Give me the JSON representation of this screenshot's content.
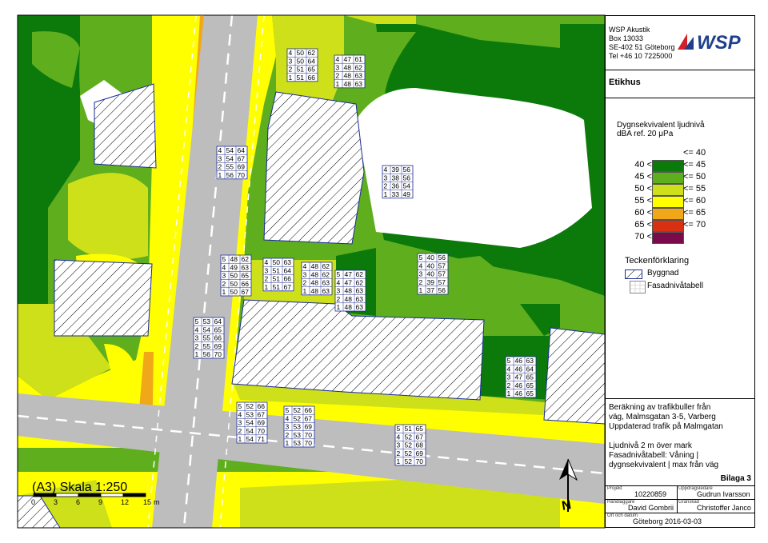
{
  "company": {
    "name": "WSP Akustik",
    "box": "Box 13033",
    "address": "SE-402 51 Göteborg",
    "phone": "Tel +46 10 7225000",
    "logo_text": "WSP"
  },
  "project_title": "Etikhus",
  "legend": {
    "title_line1": "Dygnsekvivalent ljudnivå",
    "title_line2": "dBA ref. 20 μPa",
    "classes": [
      {
        "low": "",
        "high": "<= 40",
        "color": "#ffffff"
      },
      {
        "low": "40 <",
        "high": "<= 45",
        "color": "#0b7a0b"
      },
      {
        "low": "45 <",
        "high": "<= 50",
        "color": "#5fae1e"
      },
      {
        "low": "50 <",
        "high": "<= 55",
        "color": "#cde01a"
      },
      {
        "low": "55 <",
        "high": "<= 60",
        "color": "#ffff00"
      },
      {
        "low": "60 <",
        "high": "<= 65",
        "color": "#f0a818"
      },
      {
        "low": "65 <",
        "high": "<= 70",
        "color": "#d83010"
      },
      {
        "low": "70 <",
        "high": "",
        "color": "#7a0a4a"
      }
    ]
  },
  "symbols": {
    "title": "Teckenförklaring",
    "building": "Byggnad",
    "facade_table": "Fasadnivåtabell"
  },
  "description": [
    "Beräkning av trafikbuller från",
    "väg, Malmsgatan 3-5, Varberg",
    "Uppdaterad trafik på Malmgatan",
    "",
    "Ljudnivå 2 m över mark",
    "Fasadnivåtabell: Våning |",
    "dygnsekvivalent | max från väg"
  ],
  "appendix": "Bilaga 3",
  "titleblock": {
    "projekt_label": "Projekt",
    "projekt_value": "10220859",
    "uppdragsledare_label": "Uppdragsledare",
    "uppdragsledare_value": "Gudrun Ivarsson",
    "handlaggare_label": "Handläggare",
    "handlaggare_value": "David Gombrii",
    "granskad_label": "Granskad",
    "granskad_value": "Christoffer Janco",
    "ort_label": "Ort och datum",
    "ort_value": "Göteborg 2016-03-03"
  },
  "scale": {
    "label": "(A3) Skala 1:250",
    "ticks": [
      "0",
      "3",
      "6",
      "9",
      "12",
      "15"
    ],
    "unit": "m"
  },
  "north": "N",
  "facade_tables": [
    {
      "rows": [
        [
          "4",
          "50",
          "62"
        ],
        [
          "3",
          "50",
          "64"
        ],
        [
          "2",
          "51",
          "65"
        ],
        [
          "1",
          "51",
          "66"
        ]
      ]
    },
    {
      "rows": [
        [
          "4",
          "47",
          "61"
        ],
        [
          "3",
          "48",
          "62"
        ],
        [
          "2",
          "48",
          "63"
        ],
        [
          "1",
          "48",
          "63"
        ]
      ]
    },
    {
      "rows": [
        [
          "4",
          "54",
          "64"
        ],
        [
          "3",
          "54",
          "67"
        ],
        [
          "2",
          "55",
          "69"
        ],
        [
          "1",
          "56",
          "70"
        ]
      ]
    },
    {
      "rows": [
        [
          "4",
          "39",
          "56"
        ],
        [
          "3",
          "38",
          "56"
        ],
        [
          "2",
          "36",
          "54"
        ],
        [
          "1",
          "33",
          "49"
        ]
      ]
    },
    {
      "rows": [
        [
          "5",
          "48",
          "62"
        ],
        [
          "4",
          "49",
          "63"
        ],
        [
          "3",
          "50",
          "65"
        ],
        [
          "2",
          "50",
          "66"
        ],
        [
          "1",
          "50",
          "67"
        ]
      ]
    },
    {
      "rows": [
        [
          "4",
          "50",
          "63"
        ],
        [
          "3",
          "51",
          "64"
        ],
        [
          "2",
          "51",
          "66"
        ],
        [
          "1",
          "51",
          "67"
        ]
      ]
    },
    {
      "rows": [
        [
          "4",
          "48",
          "62"
        ],
        [
          "3",
          "48",
          "62"
        ],
        [
          "2",
          "48",
          "63"
        ],
        [
          "1",
          "48",
          "63"
        ]
      ]
    },
    {
      "rows": [
        [
          "5",
          "47",
          "62"
        ],
        [
          "4",
          "47",
          "62"
        ],
        [
          "3",
          "48",
          "63"
        ],
        [
          "2",
          "48",
          "63"
        ],
        [
          "1",
          "48",
          "63"
        ]
      ]
    },
    {
      "rows": [
        [
          "5",
          "40",
          "56"
        ],
        [
          "4",
          "40",
          "57"
        ],
        [
          "3",
          "40",
          "57"
        ],
        [
          "2",
          "39",
          "57"
        ],
        [
          "1",
          "37",
          "56"
        ]
      ]
    },
    {
      "rows": [
        [
          "5",
          "53",
          "64"
        ],
        [
          "4",
          "54",
          "65"
        ],
        [
          "3",
          "55",
          "66"
        ],
        [
          "2",
          "55",
          "69"
        ],
        [
          "1",
          "56",
          "70"
        ]
      ]
    },
    {
      "rows": [
        [
          "5",
          "46",
          "63"
        ],
        [
          "4",
          "46",
          "64"
        ],
        [
          "3",
          "47",
          "65"
        ],
        [
          "2",
          "46",
          "65"
        ],
        [
          "1",
          "46",
          "65"
        ]
      ]
    },
    {
      "rows": [
        [
          "5",
          "52",
          "66"
        ],
        [
          "4",
          "53",
          "67"
        ],
        [
          "3",
          "54",
          "69"
        ],
        [
          "2",
          "54",
          "70"
        ],
        [
          "1",
          "54",
          "71"
        ]
      ]
    },
    {
      "rows": [
        [
          "5",
          "52",
          "66"
        ],
        [
          "4",
          "52",
          "67"
        ],
        [
          "3",
          "53",
          "69"
        ],
        [
          "2",
          "53",
          "70"
        ],
        [
          "1",
          "53",
          "70"
        ]
      ]
    },
    {
      "rows": [
        [
          "5",
          "51",
          "65"
        ],
        [
          "4",
          "52",
          "67"
        ],
        [
          "3",
          "52",
          "68"
        ],
        [
          "2",
          "52",
          "69"
        ],
        [
          "1",
          "52",
          "70"
        ]
      ]
    }
  ]
}
